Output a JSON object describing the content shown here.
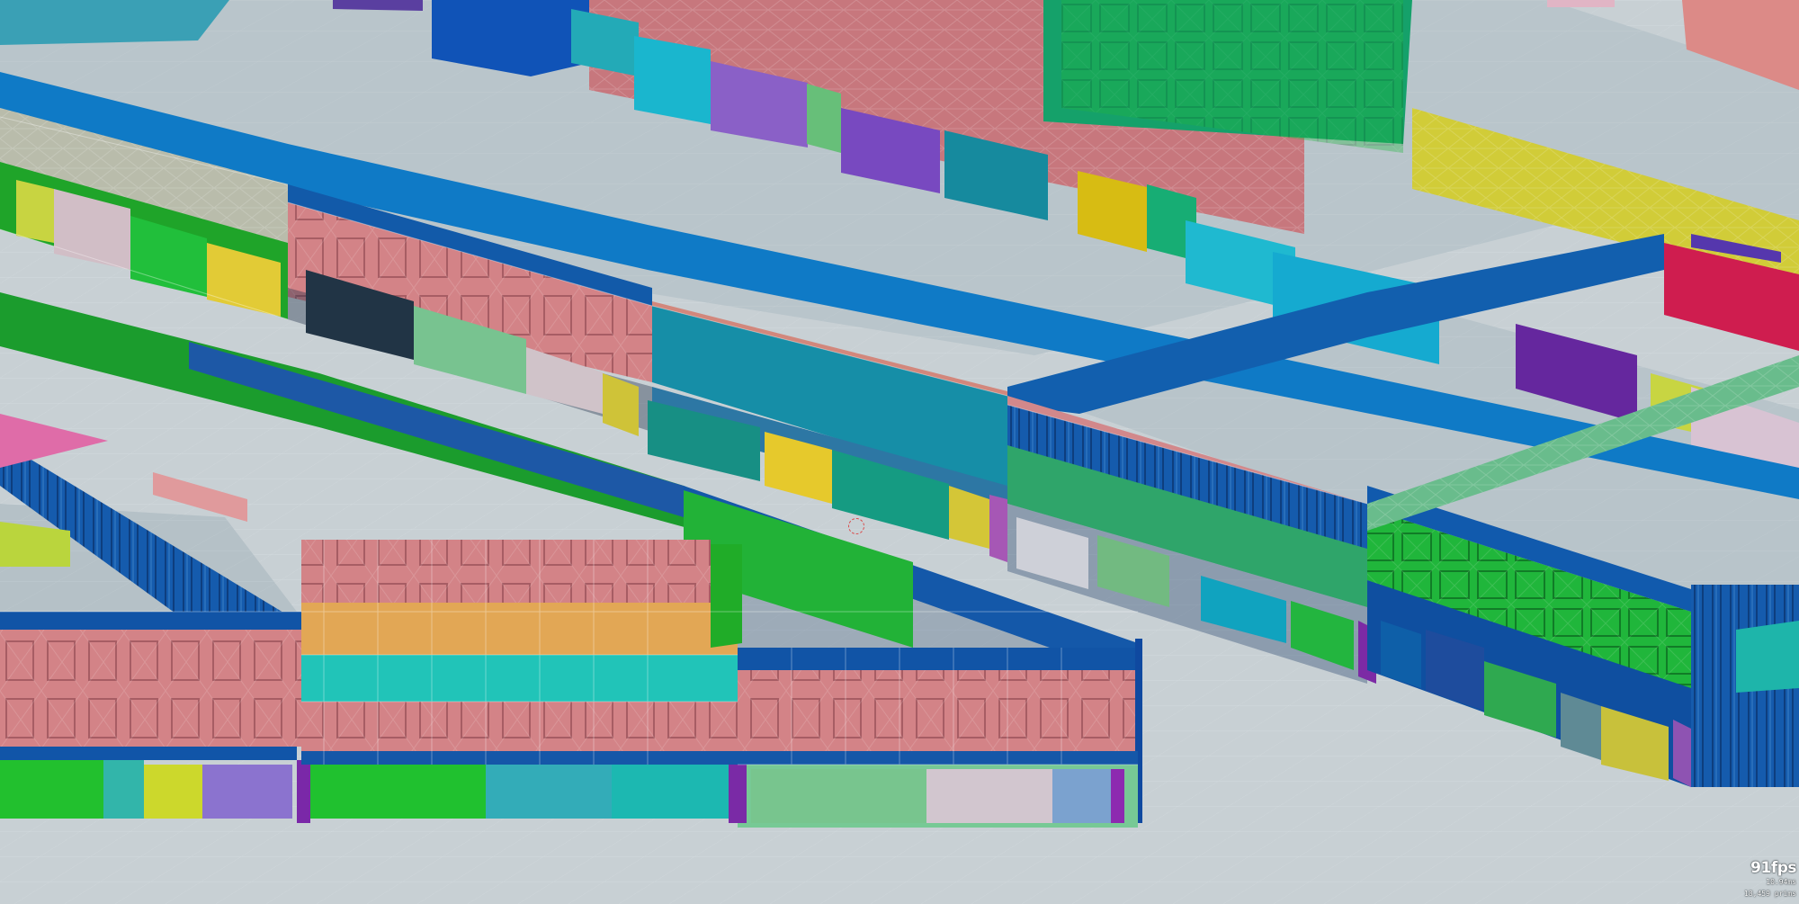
{
  "viewport": {
    "fps": "91fps",
    "frame_time": "10.94ms",
    "primitive_count": "18,459",
    "primitive_label": "prims"
  },
  "colors": {
    "floor": "#c8d0d4",
    "roof": "#b9c4ca",
    "blue_trim": "#1457a7",
    "green": "#15a526",
    "pink": "#d5868b",
    "teal": "#19aeb5",
    "yellow": "#e4c837",
    "purple": "#7143a4"
  }
}
